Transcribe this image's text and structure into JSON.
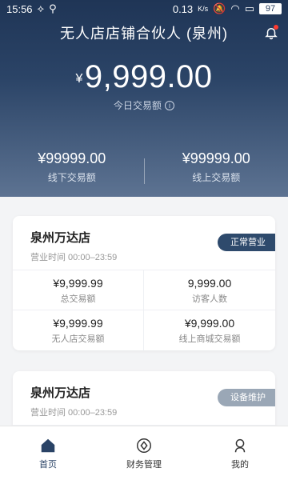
{
  "status": {
    "time": "15:56",
    "net_speed": "0.13",
    "net_unit": "K/s",
    "battery": "97"
  },
  "header": {
    "title": "无人店店铺合伙人 (泉州)"
  },
  "today": {
    "currency": "¥",
    "amount": "9,999.00",
    "label": "今日交易额",
    "info": "i"
  },
  "split": [
    {
      "value": "¥99999.00",
      "label": "线下交易额"
    },
    {
      "value": "¥99999.00",
      "label": "线上交易额"
    }
  ],
  "stores": [
    {
      "name": "泉州万达店",
      "hours": "营业时间 00:00–23:59",
      "status": "正常营业",
      "stats": [
        {
          "value": "¥9,999.99",
          "label": "总交易额"
        },
        {
          "value": "9,999.00",
          "label": "访客人数"
        },
        {
          "value": "¥9,999.99",
          "label": "无人店交易额"
        },
        {
          "value": "¥9,999.00",
          "label": "线上商城交易额"
        }
      ]
    },
    {
      "name": "泉州万达店",
      "hours": "营业时间 00:00–23:59",
      "status": "设备维护"
    }
  ],
  "tabs": [
    {
      "label": "首页",
      "icon": "home-icon"
    },
    {
      "label": "财务管理",
      "icon": "finance-icon"
    },
    {
      "label": "我的",
      "icon": "profile-icon"
    }
  ],
  "colors": {
    "primary": "#2a4366",
    "badge_normal": "#2e4a6c",
    "badge_maintenance": "#9aa7b6",
    "alert": "#ff3b30"
  }
}
